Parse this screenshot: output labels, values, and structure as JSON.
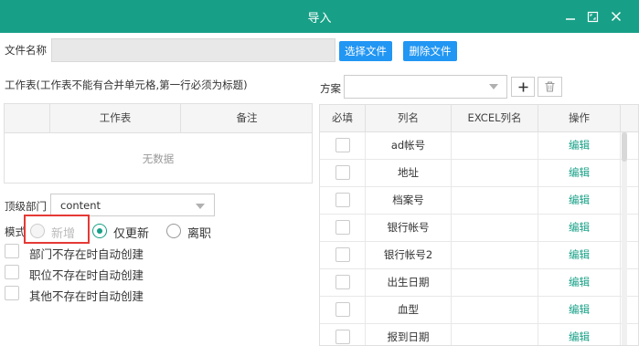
{
  "window": {
    "title": "导入"
  },
  "file": {
    "label": "文件名称",
    "choose_label": "选择文件",
    "delete_label": "删除文件"
  },
  "sheet": {
    "label": "工作表(工作表不能有合并单元格,第一行必须为标题)",
    "columns": [
      "工作表",
      "备注"
    ],
    "empty_text": "无数据"
  },
  "scheme": {
    "label": "方案"
  },
  "dept": {
    "label": "顶级部门",
    "value": "content"
  },
  "mode": {
    "label": "模式",
    "options": [
      "新增",
      "仅更新",
      "离职"
    ],
    "selected": "仅更新"
  },
  "auto_create": [
    "部门不存在时自动创建",
    "职位不存在时自动创建",
    "其他不存在时自动创建"
  ],
  "mapping": {
    "columns": [
      "必填",
      "列名",
      "EXCEL列名",
      "操作"
    ],
    "rows": [
      {
        "name": "ad帐号",
        "action": "编辑"
      },
      {
        "name": "地址",
        "action": "编辑"
      },
      {
        "name": "档案号",
        "action": "编辑"
      },
      {
        "name": "银行帐号",
        "action": "编辑"
      },
      {
        "name": "银行帐号2",
        "action": "编辑"
      },
      {
        "name": "出生日期",
        "action": "编辑"
      },
      {
        "name": "血型",
        "action": "编辑"
      },
      {
        "name": "报到日期",
        "action": "编辑"
      }
    ]
  },
  "colors": {
    "header": "#17a087",
    "button": "#2196f3",
    "highlight": "#e53935"
  }
}
